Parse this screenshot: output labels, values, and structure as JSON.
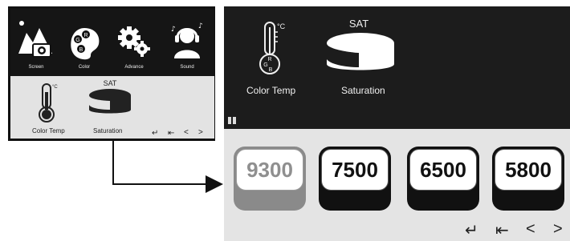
{
  "small_panel": {
    "menu": [
      {
        "label": "Screen",
        "icon": "mountain-camera-icon"
      },
      {
        "label": "Color",
        "icon": "color-palette-icon"
      },
      {
        "label": "Advance",
        "icon": "gears-icon"
      },
      {
        "label": "Sound",
        "icon": "headphones-person-icon"
      }
    ],
    "sub_items": [
      {
        "label": "Color Temp",
        "icon": "thermometer-icon",
        "unit": "°C"
      },
      {
        "label": "Saturation",
        "icon": "saturation-icon",
        "caption": "SAT"
      }
    ],
    "nav": {
      "enter": "↵",
      "exit": "⇤",
      "left": "<",
      "right": ">"
    }
  },
  "big_panel": {
    "items": [
      {
        "label": "Color Temp",
        "icon": "thermometer-icon",
        "unit": "°C"
      },
      {
        "label": "Saturation",
        "icon": "saturation-icon",
        "caption": "SAT"
      }
    ],
    "options": [
      "9300",
      "7500",
      "6500",
      "5800"
    ],
    "selected_option": "9300",
    "nav": {
      "enter": "↵",
      "exit": "⇤",
      "left": "<",
      "right": ">"
    }
  },
  "colors": {
    "dark_bg": "#1c1c1c",
    "light_bg": "#e4e4e4",
    "selected_tile": "#8a8a8a"
  }
}
